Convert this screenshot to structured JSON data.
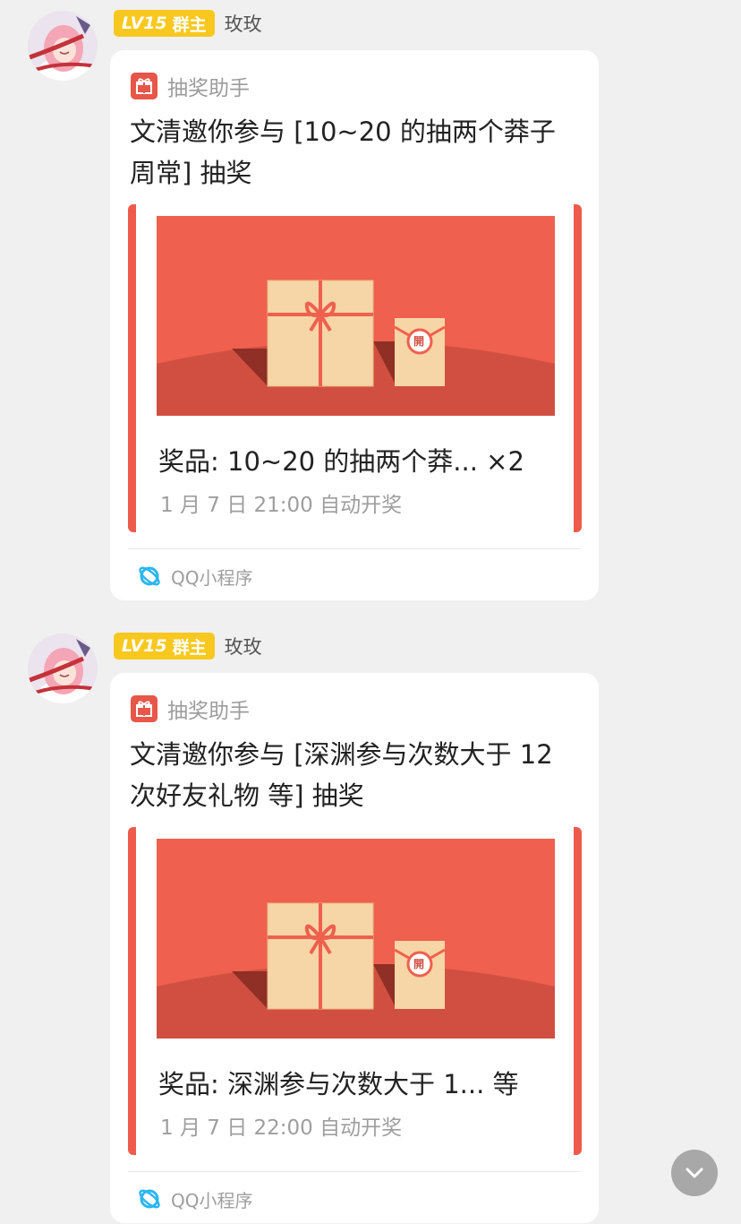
{
  "colors": {
    "background": "#f0f0f0",
    "badge": "#f8c81f",
    "accent_red": "#ee5b4c",
    "gift_box": "#f6d5a6",
    "mini_program_icon": "#2bb6f0"
  },
  "messages": [
    {
      "sender": {
        "level_label": "LV15",
        "role_label": "群主",
        "name": "玫玫"
      },
      "card": {
        "app_icon": "gift-icon",
        "app_name": "抽奖助手",
        "title": "文清邀你参与 [10~20 的抽两个莽子周常] 抽奖",
        "banner_seal_text": "開",
        "prize": "奖品: 10~20 的抽两个莽... ×2",
        "draw_time": "1 月 7 日 21:00 自动开奖",
        "footer_icon": "qq-mini-program-icon",
        "footer_label": "QQ小程序"
      }
    },
    {
      "sender": {
        "level_label": "LV15",
        "role_label": "群主",
        "name": "玫玫"
      },
      "card": {
        "app_icon": "gift-icon",
        "app_name": "抽奖助手",
        "title": "文清邀你参与 [深渊参与次数大于 12 次好友礼物 等] 抽奖",
        "banner_seal_text": "開",
        "prize": "奖品: 深渊参与次数大于 1... 等",
        "draw_time": "1 月 7 日 22:00 自动开奖",
        "footer_icon": "qq-mini-program-icon",
        "footer_label": "QQ小程序"
      }
    }
  ],
  "scroll_button": {
    "icon": "chevron-down-icon"
  }
}
